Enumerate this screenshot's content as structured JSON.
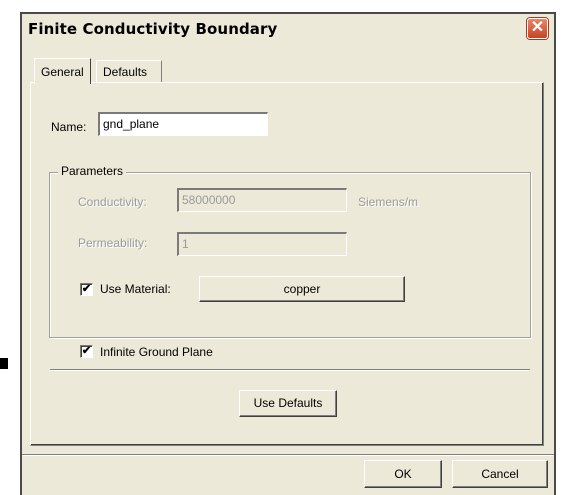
{
  "window": {
    "title": "Finite Conductivity Boundary",
    "close_glyph": "✕"
  },
  "tabs": [
    {
      "label": "General",
      "active": true
    },
    {
      "label": "Defaults",
      "active": false
    }
  ],
  "general": {
    "name_label": "Name:",
    "name_value": "gnd_plane",
    "parameters_legend": "Parameters",
    "conductivity_label": "Conductivity:",
    "conductivity_value": "58000000",
    "conductivity_unit": "Siemens/m",
    "permeability_label": "Permeability:",
    "permeability_value": "1",
    "use_material_label": "Use Material:",
    "use_material_checked": true,
    "material_button": "copper",
    "infinite_ground_label": "Infinite Ground Plane",
    "infinite_ground_checked": true,
    "use_defaults_button": "Use Defaults",
    "check_glyph": "✔"
  },
  "footer": {
    "ok_label": "OK",
    "cancel_label": "Cancel"
  }
}
